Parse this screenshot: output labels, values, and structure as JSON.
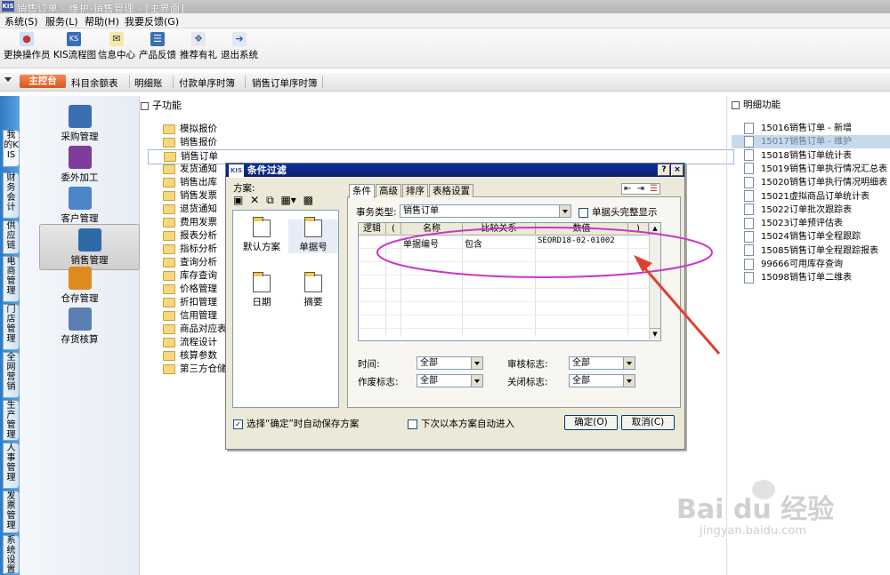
{
  "window": {
    "logo": "KIS",
    "title": "销售订单 - 维护-销售管理 - [主界面]"
  },
  "menu": [
    "系统(S)",
    "服务(L)",
    "帮助(H)",
    "我要反馈(G)"
  ],
  "toolbar": [
    "更换操作员",
    "KIS流程图",
    "信息中心",
    "产品反馈",
    "推荐有礼",
    "退出系统"
  ],
  "tabs": {
    "main": "主控台",
    "items": [
      "科目余额表",
      "明细账",
      "付款单序时簿",
      "销售订单序时簿"
    ]
  },
  "left_tabs": [
    "我的KIS",
    "财务会计",
    "供应链",
    "电商管理",
    "门店管理",
    "全网营销",
    "生产管理",
    "人事管理",
    "发票管理",
    "系统设置"
  ],
  "modules": [
    {
      "label": "采购管理",
      "color": "#3a6fb3"
    },
    {
      "label": "委外加工",
      "color": "#7c3e9a"
    },
    {
      "label": "客户管理",
      "color": "#4a86c8"
    },
    {
      "label": "销售管理",
      "color": "#2f6aa8",
      "selected": true
    },
    {
      "label": "仓存管理",
      "color": "#e08a1e"
    },
    {
      "label": "存货核算",
      "color": "#5a7fb0"
    }
  ],
  "sub_function": {
    "header": "子功能",
    "folders": [
      "模拟报价",
      "销售报价",
      "销售订单",
      "发货通知",
      "销售出库",
      "销售发票",
      "退货通知",
      "费用发票",
      "报表分析",
      "指标分析",
      "查询分析",
      "库存查询",
      "价格管理",
      "折扣管理",
      "信用管理",
      "商品对应表",
      "流程设计",
      "核算参数",
      "第三方仓储管理"
    ],
    "selected_index": 2
  },
  "detail_functions": {
    "header": "明细功能",
    "items": [
      {
        "code": "15016",
        "name": "销售订单 - 新增"
      },
      {
        "code": "15017",
        "name": "销售订单 - 维护",
        "selected": true
      },
      {
        "code": "15018",
        "name": "销售订单统计表"
      },
      {
        "code": "15019",
        "name": "销售订单执行情况汇总表"
      },
      {
        "code": "15020",
        "name": "销售订单执行情况明细表"
      },
      {
        "code": "15021",
        "name": "虚拟商品订单统计表"
      },
      {
        "code": "15022",
        "name": "订单批次跟踪表"
      },
      {
        "code": "15023",
        "name": "订单预评估表"
      },
      {
        "code": "15024",
        "name": "销售订单全程跟踪"
      },
      {
        "code": "15085",
        "name": "销售订单全程跟踪报表"
      },
      {
        "code": "99666",
        "name": "可用库存查询"
      },
      {
        "code": "15098",
        "name": "销售订单二维表"
      }
    ]
  },
  "dialog": {
    "logo": "KIS",
    "title": "条件过滤",
    "help": "?",
    "close": "×",
    "plan_label": "方案:",
    "plans": [
      "默认方案",
      "单据号",
      "日期",
      "摘要"
    ],
    "tabs": [
      "条件",
      "高级",
      "排序",
      "表格设置"
    ],
    "doc_type_label": "事务类型:",
    "doc_type_value": "销售订单",
    "full_header_label": "单据头完整显示",
    "grid_headers": [
      "逻辑",
      "(",
      "名称",
      "比较关系",
      "数值",
      ")"
    ],
    "grid_row": {
      "name": "单据编号",
      "relation": "包含",
      "value": "SEORD18-02-01002"
    },
    "filters": [
      {
        "label": "时间:",
        "value": "全部"
      },
      {
        "label": "审核标志:",
        "value": "全部"
      },
      {
        "label": "作废标志:",
        "value": "全部"
      },
      {
        "label": "关闭标志:",
        "value": "全部"
      }
    ],
    "auto_save_label": "选择“确定”时自动保存方案",
    "auto_enter_label": "下次以本方案自动进入",
    "ok": "确定(O)",
    "cancel": "取消(C)"
  },
  "watermark": {
    "brand": "Bai du 经验",
    "url": "jingyan.baidu.com"
  },
  "colors": {
    "accent_orange": "#e0662a",
    "selection_blue": "#c9d9ec",
    "dialog_title": "#0a2a8a",
    "annotation": "#cc33cc",
    "arrow": "#e04030"
  }
}
